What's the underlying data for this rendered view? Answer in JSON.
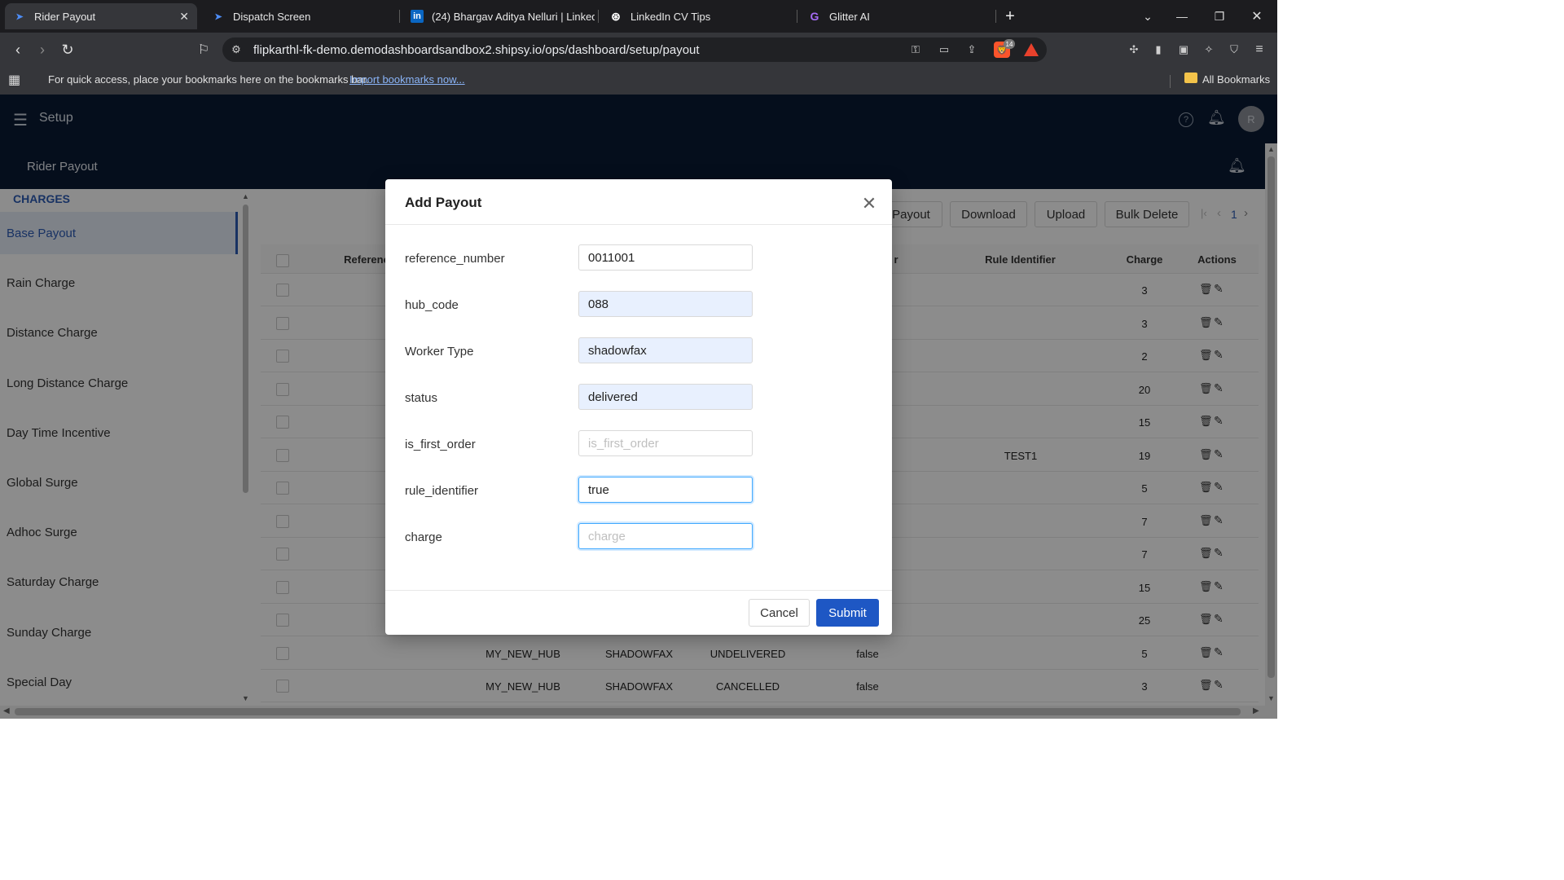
{
  "browser": {
    "tabs": [
      {
        "title": "Rider Payout",
        "close": "✕"
      },
      {
        "title": "Dispatch Screen"
      },
      {
        "title": "(24) Bhargav Aditya Nelluri | LinkedI"
      },
      {
        "title": "LinkedIn CV Tips"
      },
      {
        "title": "Glitter AI"
      }
    ],
    "url": "flipkarthl-fk-demo.demodashboardsandbox2.shipsy.io/ops/dashboard/setup/payout",
    "brave_badge": "14",
    "bookmarks_bar": {
      "message": "For quick access, place your bookmarks here on the bookmarks bar.",
      "import_link": "Import bookmarks now...",
      "all_bookmarks": "All Bookmarks"
    }
  },
  "app": {
    "header_title": "Setup",
    "avatar_letter": "R",
    "page_title": "Rider Payout"
  },
  "sidebar": {
    "section_title": "CHARGES",
    "items": [
      {
        "label": "Base Payout"
      },
      {
        "label": "Rain Charge"
      },
      {
        "label": "Distance Charge"
      },
      {
        "label": "Long Distance Charge"
      },
      {
        "label": "Day Time Incentive"
      },
      {
        "label": "Global Surge"
      },
      {
        "label": "Adhoc Surge"
      },
      {
        "label": "Saturday Charge"
      },
      {
        "label": "Sunday Charge"
      },
      {
        "label": "Special Day"
      }
    ]
  },
  "toolbar": {
    "add_payout": "Payout",
    "download": "Download",
    "upload": "Upload",
    "bulk_delete": "Bulk Delete",
    "page": "1"
  },
  "table": {
    "headers": {
      "reference": "Referenc",
      "first_order_partial": "r",
      "rule_identifier": "Rule Identifier",
      "charge": "Charge",
      "actions": "Actions"
    },
    "rows": [
      {
        "hub": "",
        "worker": "",
        "status": "",
        "first": "",
        "rule": "",
        "charge": "3"
      },
      {
        "hub": "",
        "worker": "",
        "status": "",
        "first": "",
        "rule": "",
        "charge": "3"
      },
      {
        "hub": "",
        "worker": "",
        "status": "",
        "first": "",
        "rule": "",
        "charge": "2"
      },
      {
        "hub": "",
        "worker": "",
        "status": "",
        "first": "",
        "rule": "",
        "charge": "20"
      },
      {
        "hub": "",
        "worker": "",
        "status": "",
        "first": "",
        "rule": "",
        "charge": "15"
      },
      {
        "hub": "",
        "worker": "",
        "status": "",
        "first": "",
        "rule": "TEST1",
        "charge": "19"
      },
      {
        "hub": "",
        "worker": "",
        "status": "",
        "first": "",
        "rule": "",
        "charge": "5"
      },
      {
        "hub": "",
        "worker": "",
        "status": "",
        "first": "",
        "rule": "",
        "charge": "7"
      },
      {
        "hub": "",
        "worker": "",
        "status": "",
        "first": "",
        "rule": "",
        "charge": "7"
      },
      {
        "hub": "",
        "worker": "",
        "status": "",
        "first": "",
        "rule": "",
        "charge": "15"
      },
      {
        "hub": "",
        "worker": "",
        "status": "",
        "first": "",
        "rule": "",
        "charge": "25"
      },
      {
        "hub": "MY_NEW_HUB",
        "worker": "SHADOWFAX",
        "status": "UNDELIVERED",
        "first": "false",
        "rule": "",
        "charge": "5"
      },
      {
        "hub": "MY_NEW_HUB",
        "worker": "SHADOWFAX",
        "status": "CANCELLED",
        "first": "false",
        "rule": "",
        "charge": "3"
      }
    ]
  },
  "modal": {
    "title": "Add Payout",
    "fields": [
      {
        "label": "reference_number",
        "value": "0011001",
        "placeholder": ""
      },
      {
        "label": "hub_code",
        "value": "088",
        "placeholder": ""
      },
      {
        "label": "Worker Type",
        "value": "shadowfax",
        "placeholder": ""
      },
      {
        "label": "status",
        "value": "delivered",
        "placeholder": ""
      },
      {
        "label": "is_first_order",
        "value": "",
        "placeholder": "is_first_order"
      },
      {
        "label": "rule_identifier",
        "value": "true",
        "placeholder": ""
      },
      {
        "label": "charge",
        "value": "",
        "placeholder": "charge"
      }
    ],
    "cancel": "Cancel",
    "submit": "Submit"
  },
  "colors": {
    "header_bg": "#0a1a33",
    "primary": "#1e57c4",
    "sidebar_active_bg": "#e6edf8"
  }
}
